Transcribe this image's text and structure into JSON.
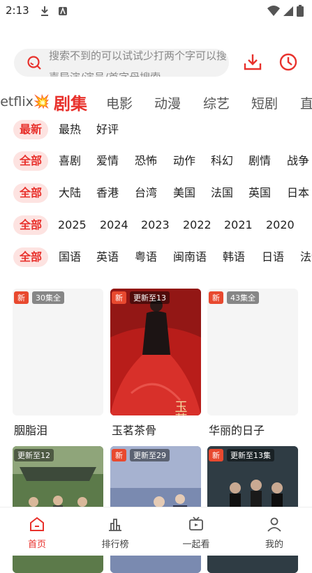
{
  "status_bar": {
    "time": "2:13"
  },
  "search": {
    "placeholder": "搜索不到的可以试试少打两个字可以搜声导演/演员/首字母搜索"
  },
  "tabs": [
    {
      "label": "Netflix💥"
    },
    {
      "label": "剧集"
    },
    {
      "label": "电影"
    },
    {
      "label": "动漫"
    },
    {
      "label": "综艺"
    },
    {
      "label": "短剧"
    },
    {
      "label": "直播"
    }
  ],
  "filters": {
    "sort": {
      "active": "最新",
      "options": [
        "最热",
        "好评"
      ]
    },
    "genre": {
      "active": "全部",
      "options": [
        "喜剧",
        "爱情",
        "恐怖",
        "动作",
        "科幻",
        "剧情",
        "战争"
      ]
    },
    "region": {
      "active": "全部",
      "options": [
        "大陆",
        "香港",
        "台湾",
        "美国",
        "法国",
        "英国",
        "日本"
      ]
    },
    "year": {
      "active": "全部",
      "options": [
        "2025",
        "2024",
        "2023",
        "2022",
        "2021",
        "2020"
      ]
    },
    "language": {
      "active": "全部",
      "options": [
        "国语",
        "英语",
        "粤语",
        "闽南语",
        "韩语",
        "日语",
        "法语"
      ]
    }
  },
  "cards": [
    {
      "title": "胭脂泪",
      "new_badge": "新",
      "episodes": "30集全",
      "poster_color": "#f5f5f5"
    },
    {
      "title": "玉茗茶骨",
      "new_badge": "新",
      "episodes": "更新至13",
      "poster_color": "#c8231f"
    },
    {
      "title": "华丽的日子",
      "new_badge": "新",
      "episodes": "43集全",
      "poster_color": "#f5f5f5"
    },
    {
      "title": "",
      "new_badge": "",
      "episodes": "更新至12",
      "poster_color": "#5c7a4a"
    },
    {
      "title": "",
      "new_badge": "新",
      "episodes": "更新至29",
      "poster_color": "#7a8ab0"
    },
    {
      "title": "",
      "new_badge": "新",
      "episodes": "更新至13集",
      "poster_color": "#2f3c44"
    }
  ],
  "poster_art": {
    "card2": "玉茗茶骨"
  },
  "bottom_nav": [
    {
      "label": "首页",
      "icon": "home-icon",
      "active": true
    },
    {
      "label": "排行榜",
      "icon": "chart-icon",
      "active": false
    },
    {
      "label": "一起看",
      "icon": "tv-icon",
      "active": false
    },
    {
      "label": "我的",
      "icon": "user-icon",
      "active": false
    }
  ],
  "colors": {
    "accent": "#e8312c",
    "chip_bg": "#fde3e1"
  }
}
